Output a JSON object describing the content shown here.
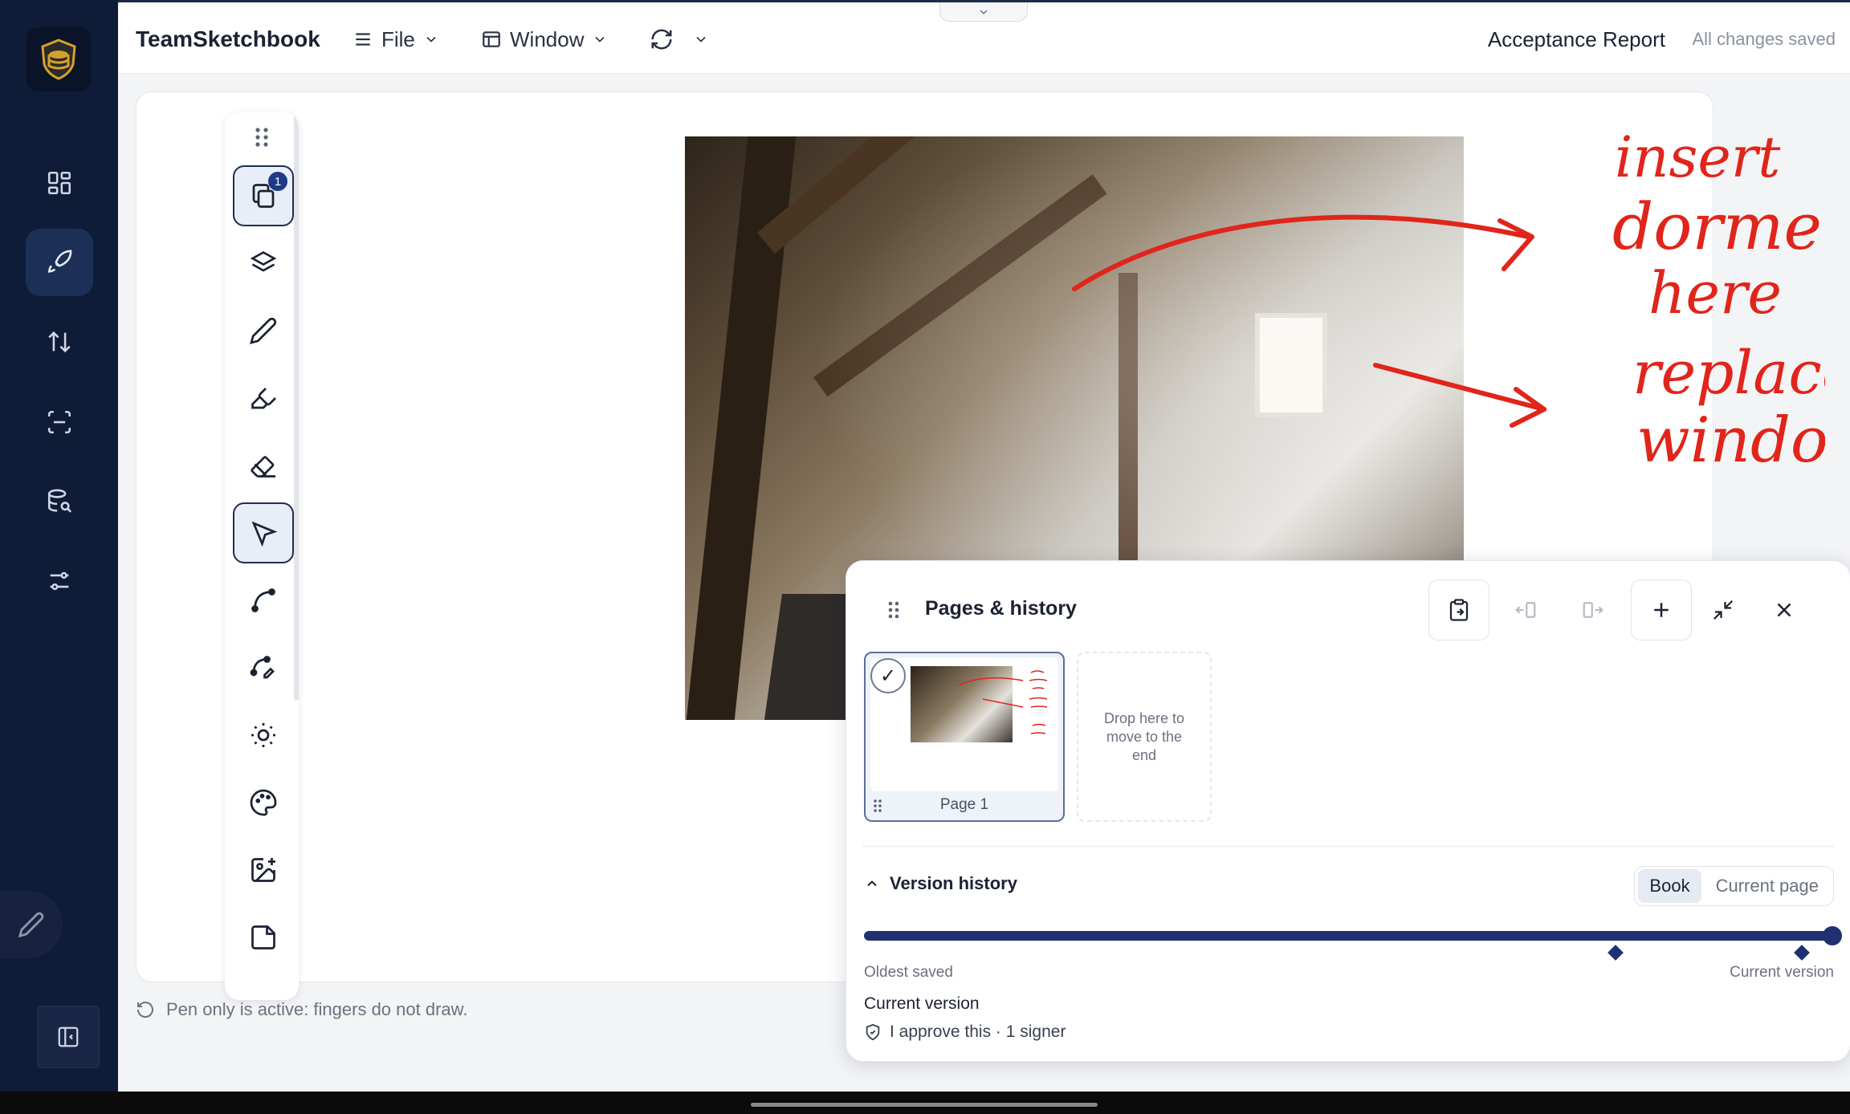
{
  "app": {
    "title": "TeamSketchbook"
  },
  "menus": {
    "file": "File",
    "window": "Window"
  },
  "document": {
    "title": "Acceptance Report",
    "save_status": "All changes saved"
  },
  "toolbar": {
    "pages_badge": "1"
  },
  "canvas": {
    "annotations": [
      "insert",
      "dormer",
      "here",
      "replace",
      "window"
    ],
    "ink_color": "#e0251b"
  },
  "status": {
    "message": "Pen only is active: fingers do not draw."
  },
  "pages_panel": {
    "title": "Pages & history",
    "pages": [
      {
        "label": "Page 1",
        "selected": true
      }
    ],
    "drop_zone": "Drop here to move to the end",
    "version_history": {
      "title": "Version history",
      "scopes": [
        "Book",
        "Current page"
      ],
      "selected_scope": "Book",
      "oldest_label": "Oldest saved",
      "current_label": "Current version",
      "current_title": "Current version",
      "signature_text": "I approve this · 1 signer",
      "position": 1.0
    }
  },
  "colors": {
    "rail": "#0f1c38",
    "accent": "#1f3170",
    "ink": "#e0251b"
  }
}
